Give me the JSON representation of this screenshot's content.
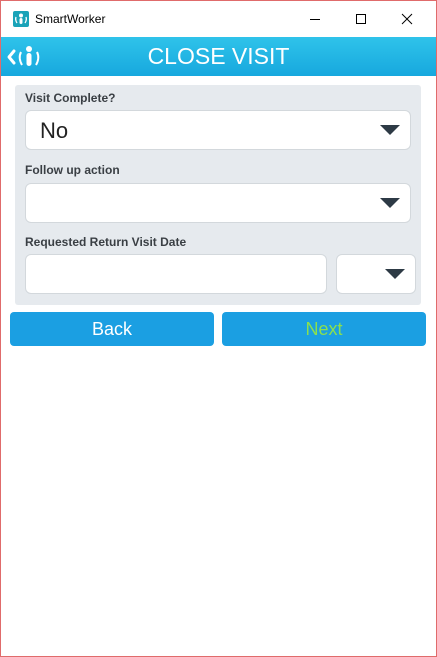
{
  "window": {
    "title": "SmartWorker"
  },
  "header": {
    "title": "CLOSE VISIT"
  },
  "form": {
    "visit_complete": {
      "label": "Visit Complete?",
      "value": "No"
    },
    "follow_up": {
      "label": "Follow up action",
      "value": ""
    },
    "return_date": {
      "label": "Requested Return Visit Date",
      "date_value": "",
      "select_value": ""
    }
  },
  "buttons": {
    "back_label": "Back",
    "next_label": "Next"
  },
  "colors": {
    "header_accent": "#17a8de",
    "button_bg": "#1b9fe2",
    "next_text": "#8be04e",
    "panel_bg": "#e6eaee"
  },
  "icons": {
    "app": "smartworker-logo-icon",
    "back": "back-chevron-icon",
    "minimize": "minimize-icon",
    "maximize": "maximize-icon",
    "close": "close-icon",
    "dropdown": "chevron-down-icon"
  }
}
